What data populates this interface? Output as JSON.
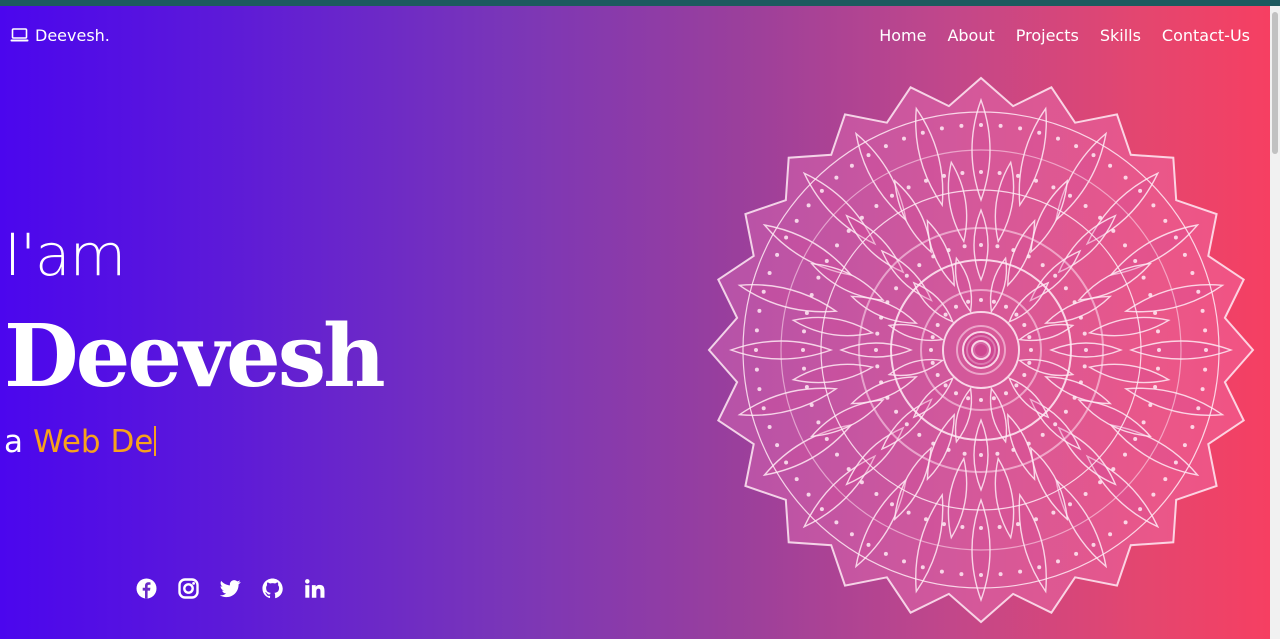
{
  "brand": {
    "icon": "laptop-icon",
    "name": "Deevesh."
  },
  "nav": [
    {
      "label": "Home"
    },
    {
      "label": "About"
    },
    {
      "label": "Projects"
    },
    {
      "label": "Skills"
    },
    {
      "label": "Contact-Us"
    }
  ],
  "hero": {
    "greeting": "I'am",
    "name": "Deevesh",
    "role_prefix": "a",
    "role_typed": "Web De"
  },
  "social": [
    {
      "icon": "facebook-icon"
    },
    {
      "icon": "instagram-icon"
    },
    {
      "icon": "twitter-icon"
    },
    {
      "icon": "github-icon"
    },
    {
      "icon": "linkedin-icon"
    }
  ],
  "colors": {
    "gradient_start": "#4b06ee",
    "gradient_end": "#f63f62",
    "accent": "#f7a21b",
    "text": "#ffffff"
  }
}
